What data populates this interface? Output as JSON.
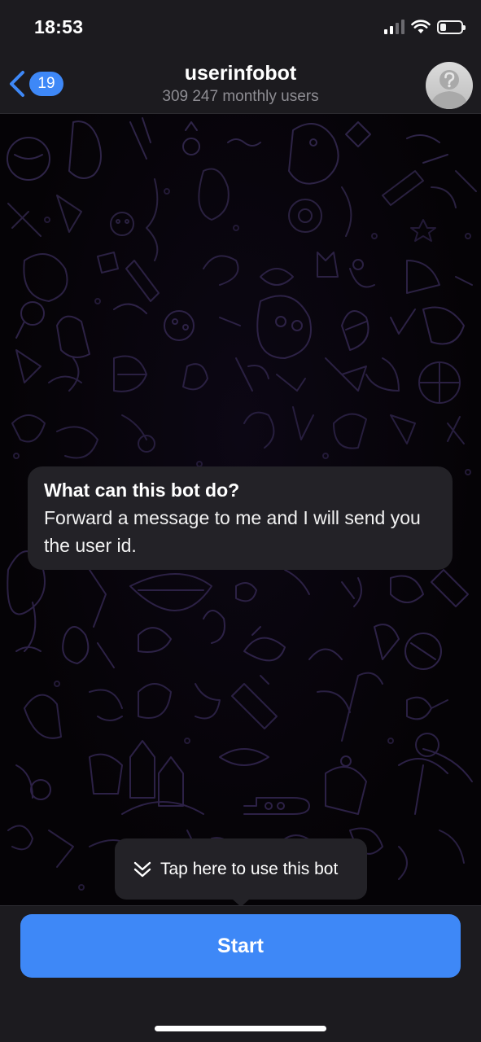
{
  "status_bar": {
    "time": "18:53",
    "icons": [
      "signal-icon",
      "wifi-icon",
      "battery-icon"
    ]
  },
  "header": {
    "back_count": "19",
    "title": "userinfobot",
    "subtitle": "309 247 monthly users",
    "avatar_icon": "question-mark-icon"
  },
  "bot_intro": {
    "title": "What can this bot do?",
    "text": "Forward a message to me and I will send you the user id."
  },
  "tooltip": {
    "icon": "chevron-down-double-icon",
    "text": "Tap here to use this bot"
  },
  "bottom_bar": {
    "start_label": "Start"
  },
  "colors": {
    "accent": "#3e88f7",
    "bar_background": "#1c1b1f",
    "bubble_background": "#232227",
    "secondary_text": "#8e8d93"
  }
}
